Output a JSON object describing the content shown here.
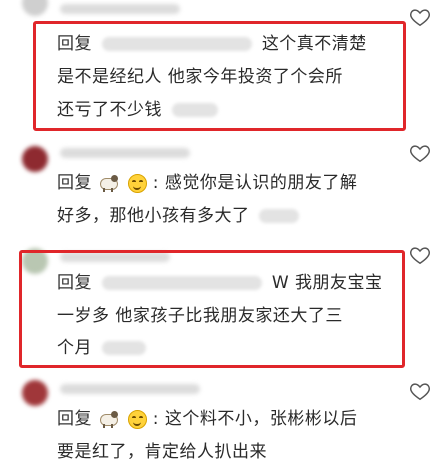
{
  "comments": [
    {
      "reply_label": "回复",
      "lines": [
        "这个真不清楚",
        "是不是经纪人  他家今年投资了个会所",
        "还亏了不少钱"
      ]
    },
    {
      "reply_label": "回复",
      "reply_separator": ":",
      "lines": [
        "感觉你是认识的朋友了解",
        "好多，那他小孩有多大了"
      ]
    },
    {
      "reply_label": "回复",
      "lines": [
        "W 我朋友宝宝",
        "一岁多 他家孩子比我朋友家还大了三",
        "个月"
      ]
    },
    {
      "reply_label": "回复",
      "reply_separator": ":",
      "lines": [
        "这个料不小，张彬彬以后",
        "要是红了，肯定给人扒出来"
      ]
    }
  ],
  "icons": {
    "heart": "heart-icon",
    "sheep": "sheep-emoji-icon",
    "smile": "smiling-face-icon"
  },
  "colors": {
    "highlight_border": "#e0262a",
    "text": "#2a2a2a"
  }
}
